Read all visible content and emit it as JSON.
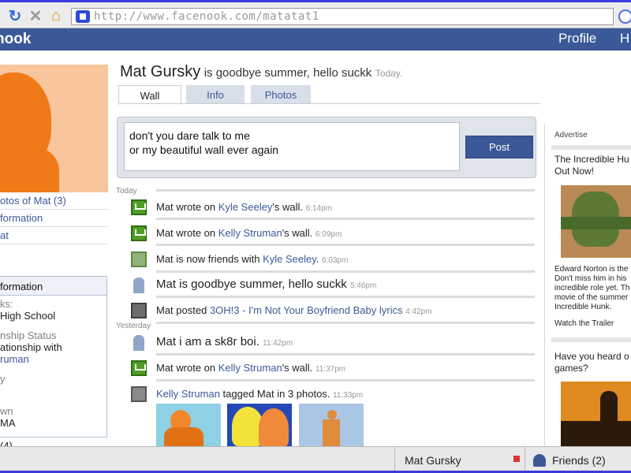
{
  "browser": {
    "url": "http://www.facenook.com/matatat1"
  },
  "header": {
    "logo": "nook",
    "nav": [
      {
        "label": "Profile"
      },
      {
        "label": "H"
      }
    ]
  },
  "sidebar": {
    "links": [
      {
        "label": "otos of Mat (3)"
      },
      {
        "label": "formation"
      },
      {
        "label": "at"
      }
    ],
    "info_box": {
      "title": "formation",
      "lines": [
        {
          "text": "ks:",
          "muted": true
        },
        {
          "text": "High School",
          "muted": false
        },
        {
          "text": "nship Status",
          "muted": true
        },
        {
          "text": "ationship with",
          "muted": false
        },
        {
          "text": "ruman",
          "muted": false
        },
        {
          "text": "y",
          "muted": true
        },
        {
          "text": "wn",
          "muted": true
        },
        {
          "text": "MA",
          "muted": false
        },
        {
          "text": "(4)",
          "muted": false
        }
      ]
    }
  },
  "profile": {
    "name": "Mat Gursky",
    "status": "is goodbye summer, hello suckk",
    "status_time": "Today."
  },
  "tabs": [
    {
      "label": "Wall",
      "active": true
    },
    {
      "label": "Info",
      "active": false
    },
    {
      "label": "Photos",
      "active": false
    }
  ],
  "composer": {
    "text": "don't you dare talk to me\nor my beautiful wall ever again",
    "button_label": "Post"
  },
  "feed": {
    "day_today": "Today",
    "day_yesterday": "Yesterday",
    "items": [
      {
        "icon": "wall-post-icon",
        "pre": "Mat wrote on ",
        "link": "Kyle Seeley",
        "post": "'s wall.",
        "time": "6:14pm"
      },
      {
        "icon": "wall-post-icon",
        "pre": "Mat wrote on ",
        "link": "Kelly Struman",
        "post": "'s wall.",
        "time": "6:09pm"
      },
      {
        "icon": "friend-add-icon",
        "pre": "Mat is now friends with ",
        "link": "Kyle Seeley",
        "post": ".",
        "time": "6:03pm"
      },
      {
        "icon": "status-person-icon",
        "pre": "Mat is goodbye summer, hello suckk",
        "link": "",
        "post": "",
        "time": "5:46pm"
      },
      {
        "icon": "film-strip-icon",
        "pre": "Mat posted ",
        "link": "3OH!3 - I'm Not Your Boyfriend Baby lyrics",
        "post": "",
        "time": "4:42pm"
      },
      {
        "icon": "status-person-icon",
        "pre": "Mat i am a sk8r boi.",
        "link": "",
        "post": "",
        "time": "11:42pm"
      },
      {
        "icon": "wall-post-icon",
        "pre": "Mat wrote on ",
        "link": "Kelly Struman",
        "post": "'s wall.",
        "time": "11:37pm"
      },
      {
        "icon": "photo-tag-icon",
        "pre": "",
        "link": "Kelly Struman",
        "post": " tagged Mat in 3 photos.",
        "time": "11:33pm"
      }
    ]
  },
  "ads": {
    "label": "Advertise",
    "ad1": {
      "title_lines": [
        "The Incredible Hu",
        "Out Now!"
      ],
      "body_lines": [
        "Edward Norton is the",
        "Don't miss him in his",
        "incredible role yet. Th",
        "movie of the summer",
        "Incredible Hunk."
      ],
      "link": "Watch the Trailer"
    },
    "ad2": {
      "title_lines": [
        "Have you heard o",
        "games?"
      ]
    }
  },
  "chat_bar": {
    "user": "Mat Gursky",
    "friends": "Friends (2)"
  },
  "colors": {
    "brand": "#3b5998",
    "link": "#3b5998",
    "wall_icon": "#4f9e28"
  }
}
